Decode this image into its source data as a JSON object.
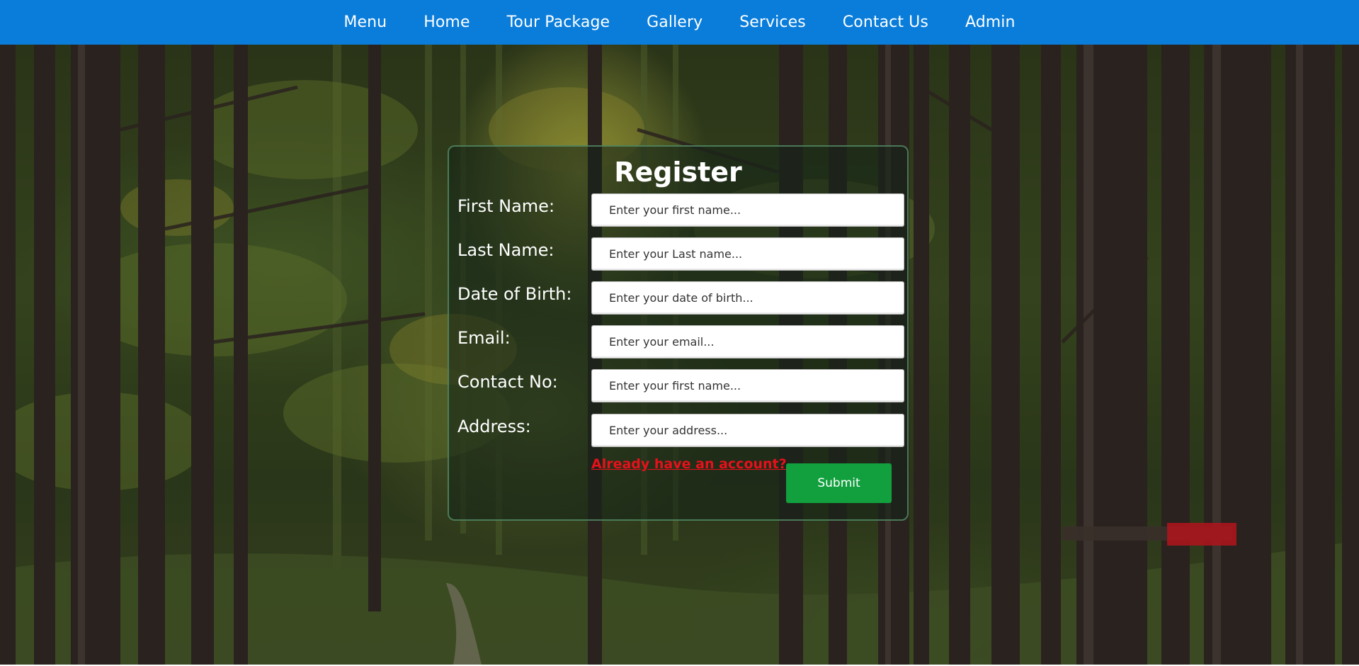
{
  "nav": {
    "items": [
      {
        "label": "Menu"
      },
      {
        "label": "Home"
      },
      {
        "label": "Tour Package"
      },
      {
        "label": "Gallery"
      },
      {
        "label": "Services"
      },
      {
        "label": "Contact Us"
      },
      {
        "label": "Admin"
      }
    ],
    "bar_color": "#0a7ddb"
  },
  "register": {
    "title": "Register",
    "fields": [
      {
        "label": "First Name:",
        "placeholder": "Enter your first name...",
        "value": ""
      },
      {
        "label": "Last Name:",
        "placeholder": "Enter your Last name...",
        "value": ""
      },
      {
        "label": "Date of Birth:",
        "placeholder": "Enter your date of birth...",
        "value": ""
      },
      {
        "label": "Email:",
        "placeholder": "Enter your email...",
        "value": ""
      },
      {
        "label": "Contact No:",
        "placeholder": "Enter your first name...",
        "value": ""
      },
      {
        "label": "Address:",
        "placeholder": "Enter your address...",
        "value": ""
      }
    ],
    "login_link": "Already have an account?",
    "submit_label": "Submit",
    "link_color": "#e8101a",
    "submit_color": "#12a03f"
  },
  "background": {
    "description_icon": "forest-background"
  }
}
